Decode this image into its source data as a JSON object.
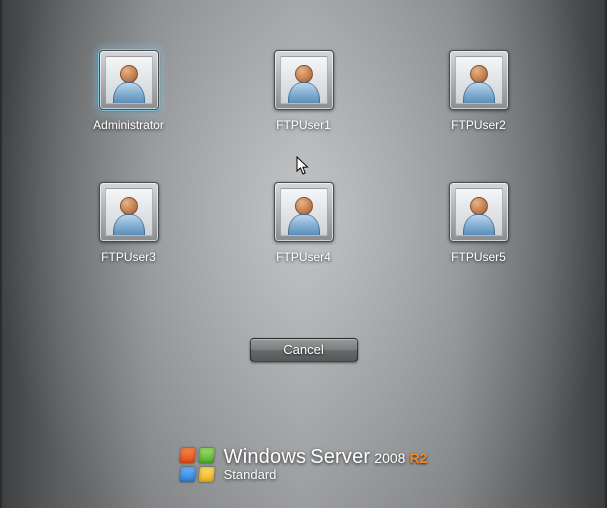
{
  "users": [
    {
      "name": "Administrator",
      "selected": true
    },
    {
      "name": "FTPUser1",
      "selected": false
    },
    {
      "name": "FTPUser2",
      "selected": false
    },
    {
      "name": "FTPUser3",
      "selected": false
    },
    {
      "name": "FTPUser4",
      "selected": false
    },
    {
      "name": "FTPUser5",
      "selected": false
    }
  ],
  "cancel_label": "Cancel",
  "branding": {
    "product_a": "Windows",
    "product_b": "Server",
    "year": "2008",
    "suffix": "R2",
    "edition": "Standard"
  }
}
